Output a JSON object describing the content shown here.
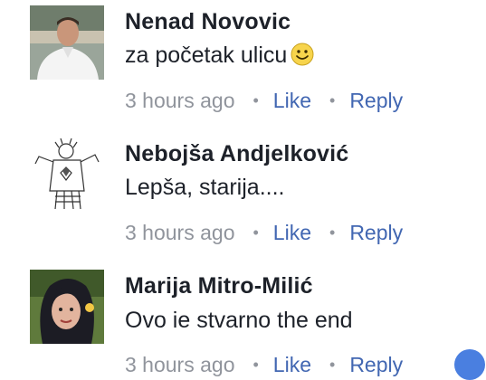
{
  "comments": [
    {
      "author": "Nenad Novovic",
      "text": "za početak ulicu",
      "emoji": "smile-emoji",
      "time": "3 hours ago",
      "like": "Like",
      "reply": "Reply"
    },
    {
      "author": "Nebojša Andjelković",
      "text": "Lepša, starija....",
      "time": "3 hours ago",
      "like": "Like",
      "reply": "Reply"
    },
    {
      "author": "Marija Mitro-Milić",
      "text": "Ovo ie stvarno the end",
      "time": "3 hours ago",
      "like": "Like",
      "reply": "Reply"
    }
  ],
  "separator": "•",
  "colors": {
    "link": "#4267b2",
    "meta": "#90949c",
    "text": "#1d2129"
  }
}
